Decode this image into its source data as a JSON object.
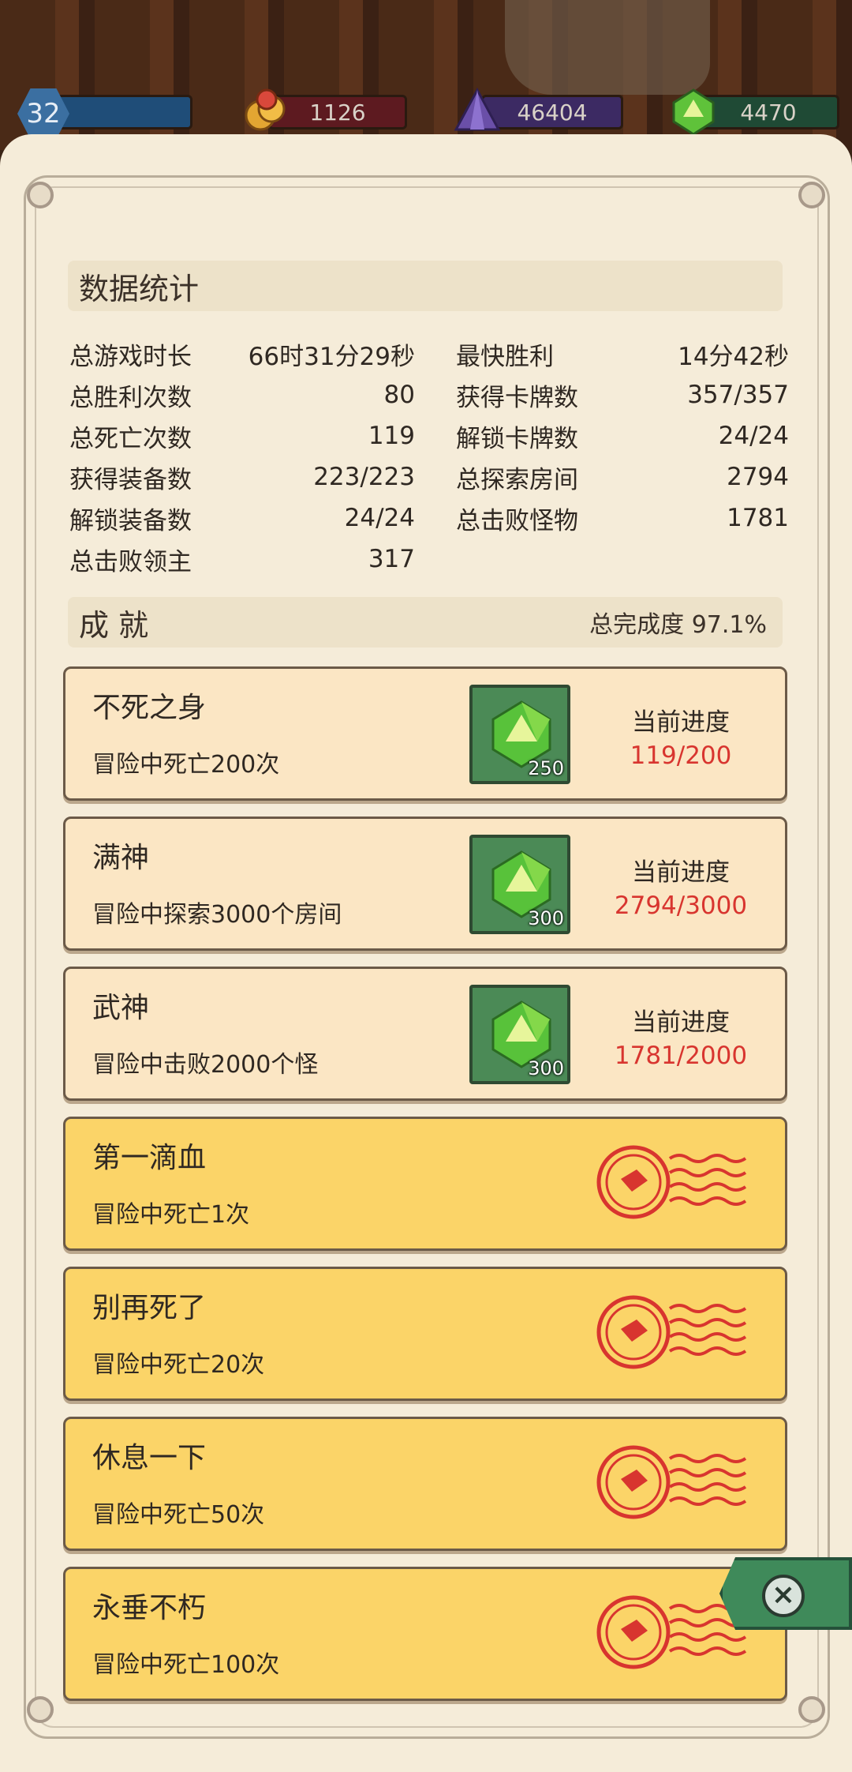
{
  "resources": {
    "level": "32",
    "gold": "1126",
    "purple_gems": "46404",
    "green_gems": "4470",
    "colors": {
      "blue": "#1f4d78",
      "red": "#5d1a20",
      "purple": "#3c2a63",
      "green": "#1f4a35"
    }
  },
  "stats": {
    "header": "数据统计",
    "left": [
      {
        "label": "总游戏时长",
        "value": "66时31分29秒"
      },
      {
        "label": "总胜利次数",
        "value": "80"
      },
      {
        "label": "总死亡次数",
        "value": "119"
      },
      {
        "label": "获得装备数",
        "value": "223/223"
      },
      {
        "label": "解锁装备数",
        "value": "24/24"
      },
      {
        "label": "总击败领主",
        "value": "317"
      }
    ],
    "right": [
      {
        "label": "最快胜利",
        "value": "14分42秒"
      },
      {
        "label": "获得卡牌数",
        "value": "357/357"
      },
      {
        "label": "解锁卡牌数",
        "value": "24/24"
      },
      {
        "label": "总探索房间",
        "value": "2794"
      },
      {
        "label": "总击败怪物",
        "value": "1781"
      }
    ]
  },
  "achievements": {
    "header": "成 就",
    "completion": "总完成度 97.1%",
    "progress_label": "当前进度",
    "items": [
      {
        "title": "不死之身",
        "desc": "冒险中死亡200次",
        "reward": "250",
        "progress": "119/200",
        "status": "locked"
      },
      {
        "title": "满神",
        "desc": "冒险中探索3000个房间",
        "reward": "300",
        "progress": "2794/3000",
        "status": "locked"
      },
      {
        "title": "武神",
        "desc": "冒险中击败2000个怪",
        "reward": "300",
        "progress": "1781/2000",
        "status": "locked"
      },
      {
        "title": "第一滴血",
        "desc": "冒险中死亡1次",
        "status": "completed"
      },
      {
        "title": "别再死了",
        "desc": "冒险中死亡20次",
        "status": "completed"
      },
      {
        "title": "休息一下",
        "desc": "冒险中死亡50次",
        "status": "completed"
      },
      {
        "title": "永垂不朽",
        "desc": "冒险中死亡100次",
        "status": "completed"
      }
    ]
  },
  "icons": {
    "close": "close-icon",
    "gem": "green-gem-icon",
    "stamp": "completed-stamp-icon"
  }
}
